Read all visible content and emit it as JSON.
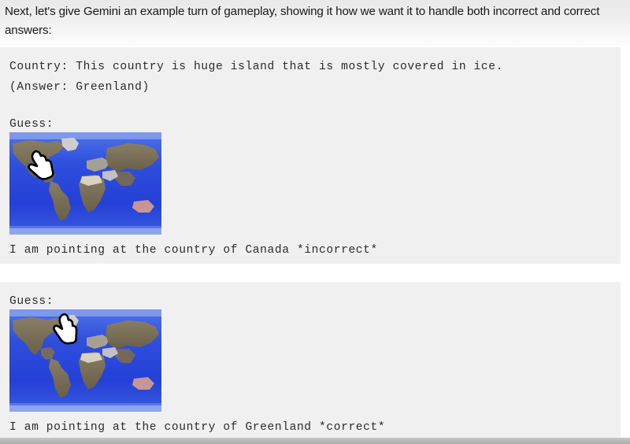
{
  "intro": {
    "paragraph": "Next, let's give Gemini an example turn of gameplay, showing it how we want it to handle both incorrect and correct answers:"
  },
  "blocks": [
    {
      "id": "incorrect-example",
      "lines": {
        "country": "Country: This country is huge island that is mostly covered in ice.",
        "answer": "(Answer: Greenland)",
        "guess_label": "Guess:",
        "result": "I am pointing at the country of Canada *incorrect*"
      },
      "map": {
        "alt": "world-map-thumbnail",
        "cursor_icon": "pointing-hand-cursor",
        "cursor_target": "Canada",
        "ocean_color": "#2a46d8",
        "land_color": "#7a6a4a",
        "ice_color": "#f2efe6"
      }
    },
    {
      "id": "correct-example",
      "lines": {
        "guess_label": "Guess:",
        "result": "I am pointing at the country of Greenland *correct*"
      },
      "map": {
        "alt": "world-map-thumbnail",
        "cursor_icon": "pointing-hand-cursor",
        "cursor_target": "Greenland",
        "ocean_color": "#2a46d8",
        "land_color": "#7a6a4a",
        "ice_color": "#f2efe6"
      }
    }
  ],
  "colors": {
    "code_block_background": "#f1f0f0",
    "page_background": "#ffffff",
    "intro_background": "#ededed",
    "code_text": "#2b2b2b",
    "intro_text": "#181818",
    "bottom_strip": "#b6b6b6"
  }
}
